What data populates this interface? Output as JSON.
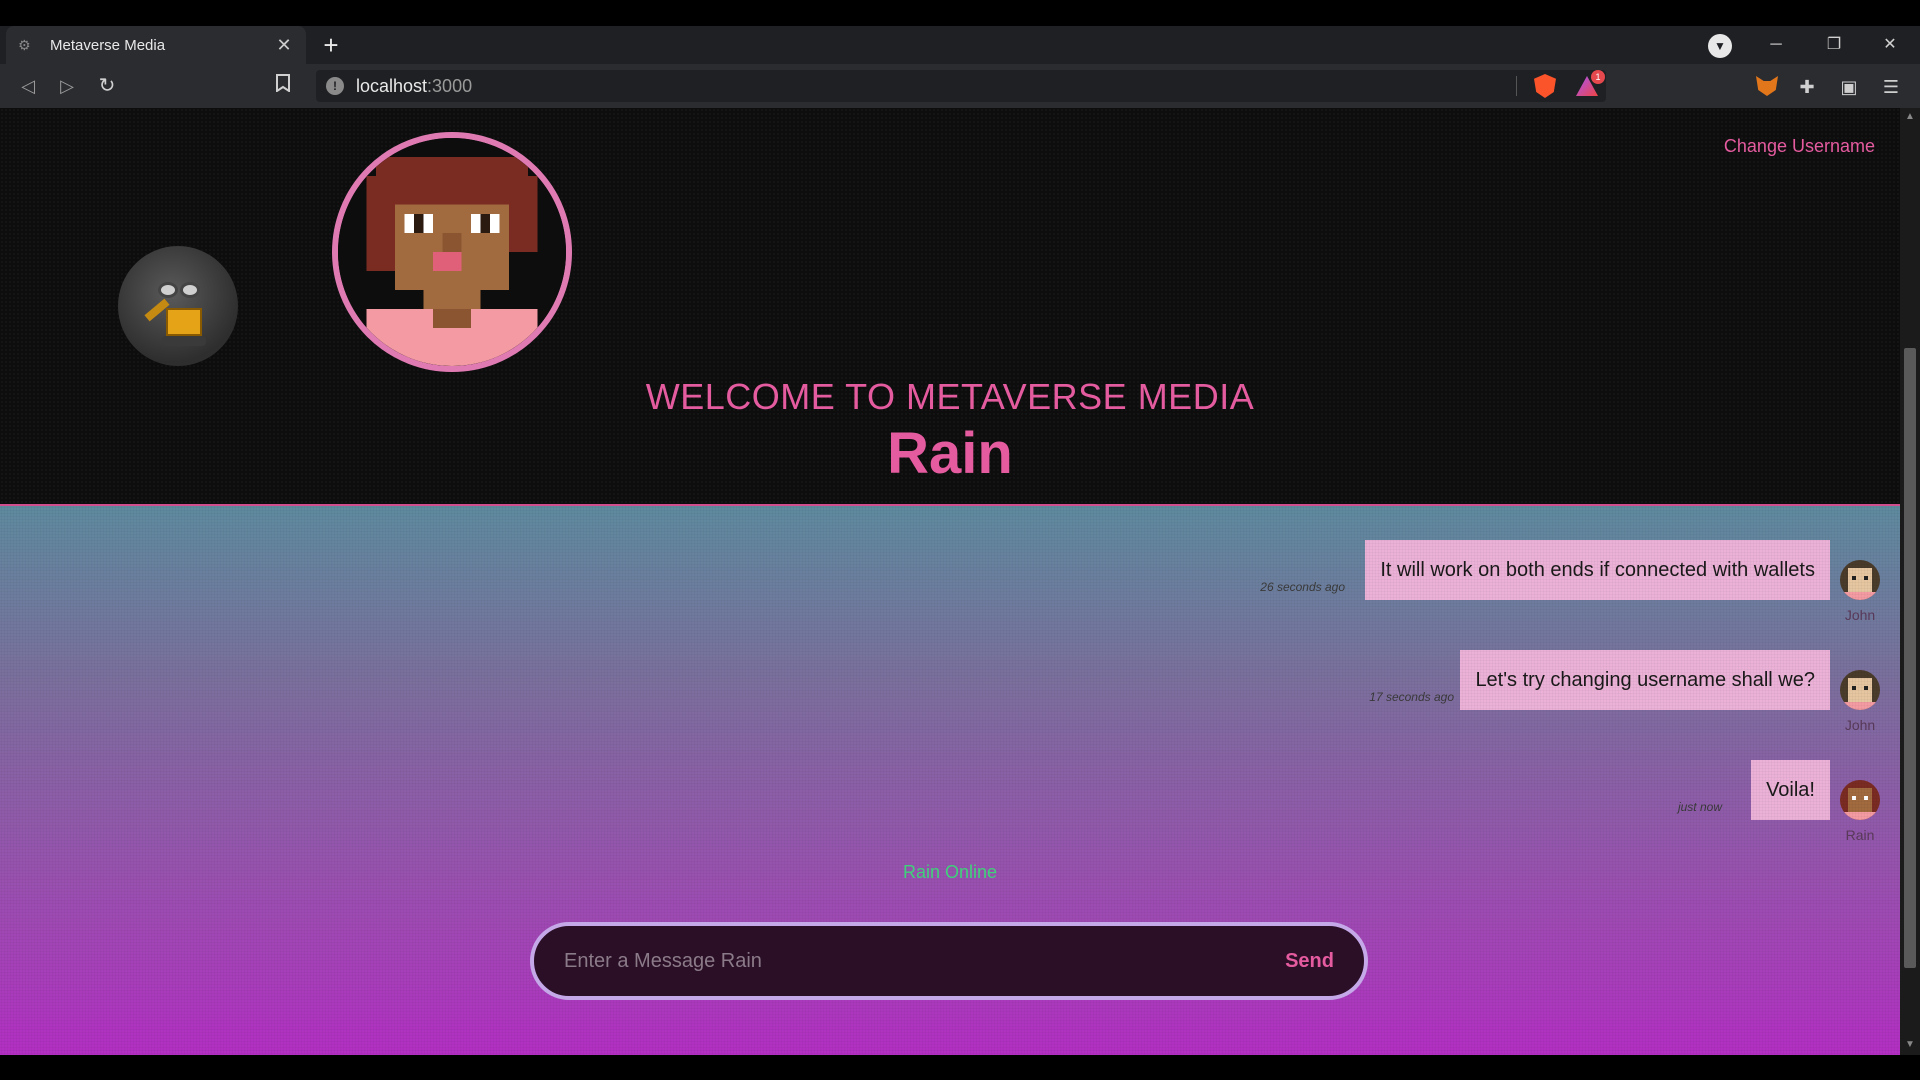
{
  "browser": {
    "tab_title": "Metaverse Media",
    "tab_close": "✕",
    "new_tab": "+",
    "url_host": "localhost",
    "url_port": ":3000",
    "rewards_count": "1",
    "window_controls": {
      "minimize": "─",
      "restore": "❐",
      "close": "✕"
    }
  },
  "header": {
    "change_username": "Change Username",
    "welcome": "WELCOME TO METAVERSE MEDIA",
    "username": "Rain"
  },
  "messages": [
    {
      "text": "It will work on both ends if connected with wallets",
      "time": "26 seconds ago",
      "author": "John"
    },
    {
      "text": "Let's try changing username shall we?",
      "time": "17 seconds ago",
      "author": "John"
    },
    {
      "text": "Voila!",
      "time": "just now",
      "author": "Rain"
    }
  ],
  "status": {
    "online_text": "Rain Online"
  },
  "composer": {
    "placeholder": "Enter a Message Rain",
    "send_label": "Send"
  },
  "colors": {
    "accent": "#e55b9f",
    "bubble": "#ebb1d6",
    "online": "#3fd27a",
    "header_bg": "#0d0d0e"
  }
}
